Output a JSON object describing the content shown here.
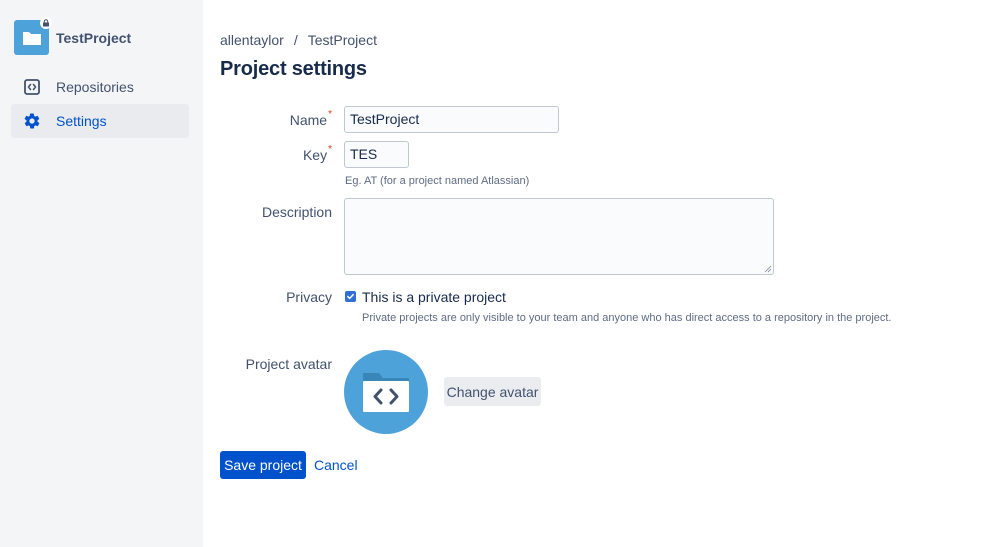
{
  "sidebar": {
    "project_name": "TestProject",
    "items": [
      {
        "label": "Repositories",
        "icon": "code-brackets-icon",
        "active": false
      },
      {
        "label": "Settings",
        "icon": "gear-icon",
        "active": true
      }
    ]
  },
  "breadcrumb": {
    "owner": "allentaylor",
    "separator": "/",
    "project": "TestProject"
  },
  "page": {
    "title": "Project settings"
  },
  "form": {
    "name": {
      "label": "Name",
      "required_mark": "*",
      "value": "TestProject"
    },
    "key": {
      "label": "Key",
      "required_mark": "*",
      "value": "TES",
      "help": "Eg. AT (for a project named Atlassian)"
    },
    "description": {
      "label": "Description",
      "value": ""
    },
    "privacy": {
      "label": "Privacy",
      "checkbox_label": "This is a private project",
      "checked": true,
      "help": "Private projects are only visible to your team and anyone who has direct access to a repository in the project."
    },
    "avatar": {
      "label": "Project avatar",
      "change_label": "Change avatar",
      "icon": "project-folder-code-icon"
    }
  },
  "actions": {
    "save_label": "Save project",
    "cancel_label": "Cancel"
  },
  "colors": {
    "accent": "#0052cc",
    "avatar": "#4da3d9",
    "sidebar_bg": "#f4f5f7",
    "required": "#de350b"
  }
}
